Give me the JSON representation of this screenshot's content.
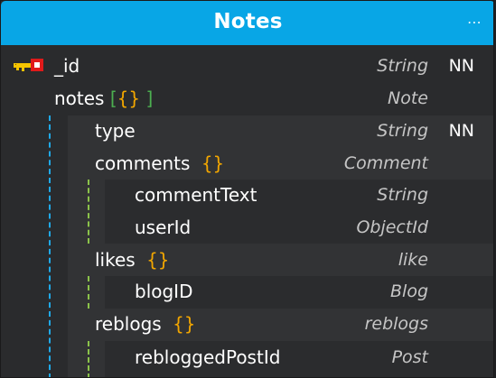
{
  "collection": {
    "title": "Notes",
    "menu_icon": "⋯"
  },
  "fields": {
    "id": {
      "name": "_id",
      "type": "String",
      "nn": "NN",
      "icon": "primary-key-icon"
    },
    "notes": {
      "name": "notes",
      "open": "[",
      "brace": "{}",
      "close": "]",
      "type": "Note"
    },
    "type": {
      "name": "type",
      "type": "String",
      "nn": "NN"
    },
    "comments": {
      "name": "comments",
      "brace": "{}",
      "type": "Comment"
    },
    "commentText": {
      "name": "commentText",
      "type": "String"
    },
    "userId": {
      "name": "userId",
      "type": "ObjectId"
    },
    "likes": {
      "name": "likes",
      "brace": "{}",
      "type": "like"
    },
    "blogID": {
      "name": "blogID",
      "type": "Blog"
    },
    "reblogs": {
      "name": "reblogs",
      "brace": "{}",
      "type": "reblogs"
    },
    "rebloggedPostId": {
      "name": "rebloggedPostId",
      "type": "Post"
    }
  },
  "colors": {
    "header": "#08a6e6",
    "array_bracket": "#4caf50",
    "object_brace": "#f2a600",
    "nesting_line_blue": "#1fa9e8",
    "nesting_line_green": "#8bc34a"
  }
}
